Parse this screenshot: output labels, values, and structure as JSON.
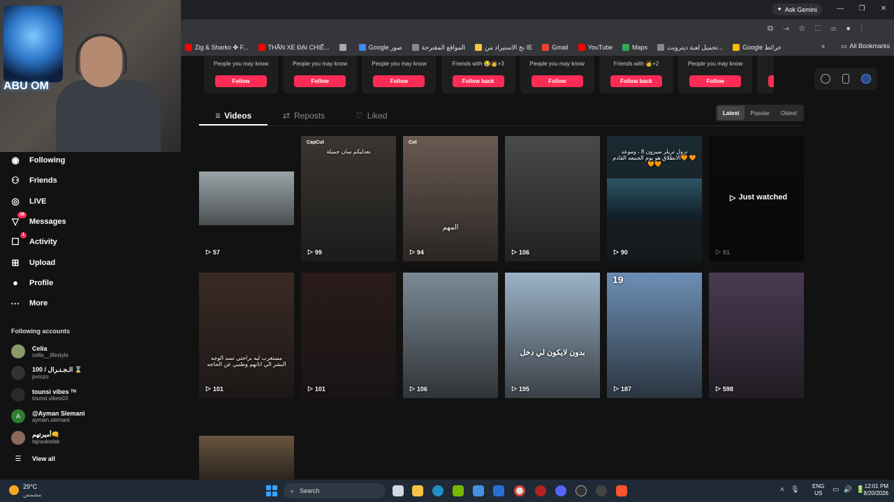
{
  "browser": {
    "gemini_label": "Ask Gemini",
    "bookmarks": [
      {
        "label": "Zig & Sharko ✤ F...",
        "color": "#ff0000"
      },
      {
        "label": "THẦN XE ĐẠI CHIẾ...",
        "color": "#ff0000"
      },
      {
        "label": "",
        "color": "#aaaaaa"
      },
      {
        "label": "Google صور",
        "color": "#4285f4"
      },
      {
        "label": "المواقع المقترحة",
        "color": "#888888"
      },
      {
        "label": "نخ الاستيراد من IE",
        "color": "#f4c542"
      },
      {
        "label": "Gmail",
        "color": "#ea4335"
      },
      {
        "label": "YouTube",
        "color": "#ff0000"
      },
      {
        "label": "Maps",
        "color": "#34a853"
      },
      {
        "label": "تحميل لعبة ديتروبت...",
        "color": "#888888"
      },
      {
        "label": "Google خرائط",
        "color": "#fbbc05"
      }
    ],
    "all_bookmarks": "All Bookmarks"
  },
  "stream": {
    "logo_text": "ABU OM"
  },
  "sidebar": {
    "nav": [
      {
        "label": "Following",
        "icon": "following-icon",
        "glyph": "◉",
        "badge": ""
      },
      {
        "label": "Friends",
        "icon": "friends-icon",
        "glyph": "⚇",
        "badge": ""
      },
      {
        "label": "LIVE",
        "icon": "live-icon",
        "glyph": "◎",
        "badge": ""
      },
      {
        "label": "Messages",
        "icon": "messages-icon",
        "glyph": "▽",
        "badge": "16"
      },
      {
        "label": "Activity",
        "icon": "activity-icon",
        "glyph": "☐",
        "badge": "1"
      },
      {
        "label": "Upload",
        "icon": "upload-icon",
        "glyph": "⊞",
        "badge": ""
      },
      {
        "label": "Profile",
        "icon": "profile-icon",
        "glyph": "●",
        "badge": ""
      },
      {
        "label": "More",
        "icon": "more-icon",
        "glyph": "···",
        "badge": ""
      }
    ],
    "following_heading": "Following accounts",
    "accounts": [
      {
        "name": "Celia",
        "handle": "cella__lifestyle",
        "initial": ""
      },
      {
        "name": "100 / الـجـنـرال ⌛",
        "handle": "pvmzo",
        "initial": ""
      },
      {
        "name": "tounsi vibes ᵀᴺ",
        "handle": "tounsi.vibes03",
        "initial": ""
      },
      {
        "name": "@Ayman Slemani",
        "handle": "ayman.slemani",
        "initial": "A"
      },
      {
        "name": "أميرتهم👊",
        "handle": "tajraskwlak",
        "initial": ""
      }
    ],
    "view_all": "View all"
  },
  "suggestions": [
    {
      "sub": "People you may know",
      "button": "Follow"
    },
    {
      "sub": "People you may know",
      "button": "Follow"
    },
    {
      "sub": "People you may know",
      "button": "Follow"
    },
    {
      "sub": "Friends with 😂🧑+3",
      "button": "Follow back"
    },
    {
      "sub": "People you may know",
      "button": "Follow"
    },
    {
      "sub": "Friends with 🧑+2",
      "button": "Follow back"
    },
    {
      "sub": "People you may know",
      "button": "Follow"
    },
    {
      "sub": "People you",
      "button": "Fol"
    }
  ],
  "tabs": [
    {
      "label": "Videos",
      "icon": "grid-icon",
      "glyph": "⦙⦙⦙"
    },
    {
      "label": "Reposts",
      "icon": "repost-icon",
      "glyph": "⇄"
    },
    {
      "label": "Liked",
      "icon": "heart-icon",
      "glyph": "♡"
    }
  ],
  "sort": [
    "Latest",
    "Popular",
    "Oldest"
  ],
  "videos": [
    {
      "views": "57",
      "caption": "",
      "top_caption": "",
      "bg": "#5a5f63"
    },
    {
      "views": "99",
      "caption": "",
      "top_caption": "بعدليكم سان جميلة",
      "bg": "#3a3632",
      "badge": "CapCut"
    },
    {
      "views": "94",
      "caption": "المهم",
      "top_caption": "",
      "bg": "#6a5a52",
      "badge": "Cut"
    },
    {
      "views": "106",
      "caption": "",
      "top_caption": "",
      "bg": "#4a4a4a"
    },
    {
      "views": "90",
      "caption": "",
      "top_caption": "نزول تريلر سيزون 8 ، وموعد الانطلاق هو يوم الجمعه القادم🧡 🧡🧡🧡",
      "bg": "#1b2a33"
    },
    {
      "views": "91",
      "caption": "",
      "top_caption": "",
      "bg": "#1d1a18",
      "watched": "Just watched"
    },
    {
      "views": "101",
      "caption": "مستغرب ليه براحتي تسد الوجه البشر الي اتانهم وطنبي عن الحاجه",
      "top_caption": "",
      "bg": "#3a2a26"
    },
    {
      "views": "101",
      "caption": "",
      "top_caption": "",
      "bg": "#2a1b1b"
    },
    {
      "views": "106",
      "caption": "",
      "top_caption": "",
      "bg": "#7b8a96"
    },
    {
      "views": "195",
      "caption": "بدون لايكون لي دخل",
      "top_caption": "",
      "bg": "#9bb3c8"
    },
    {
      "views": "187",
      "caption": "",
      "top_caption": "19",
      "bg": "#6d8fb5"
    },
    {
      "views": "598",
      "caption": "",
      "top_caption": "",
      "bg": "#4a3a52"
    },
    {
      "views": "",
      "caption": "",
      "top_caption": "",
      "bg": "#6a5540"
    }
  ],
  "taskbar": {
    "weather_temp": "29°C",
    "weather_desc": "مشمس",
    "search": "Search",
    "lang": "ENG",
    "region": "US",
    "time": "12:01 PM",
    "date": "8/20/2026"
  }
}
